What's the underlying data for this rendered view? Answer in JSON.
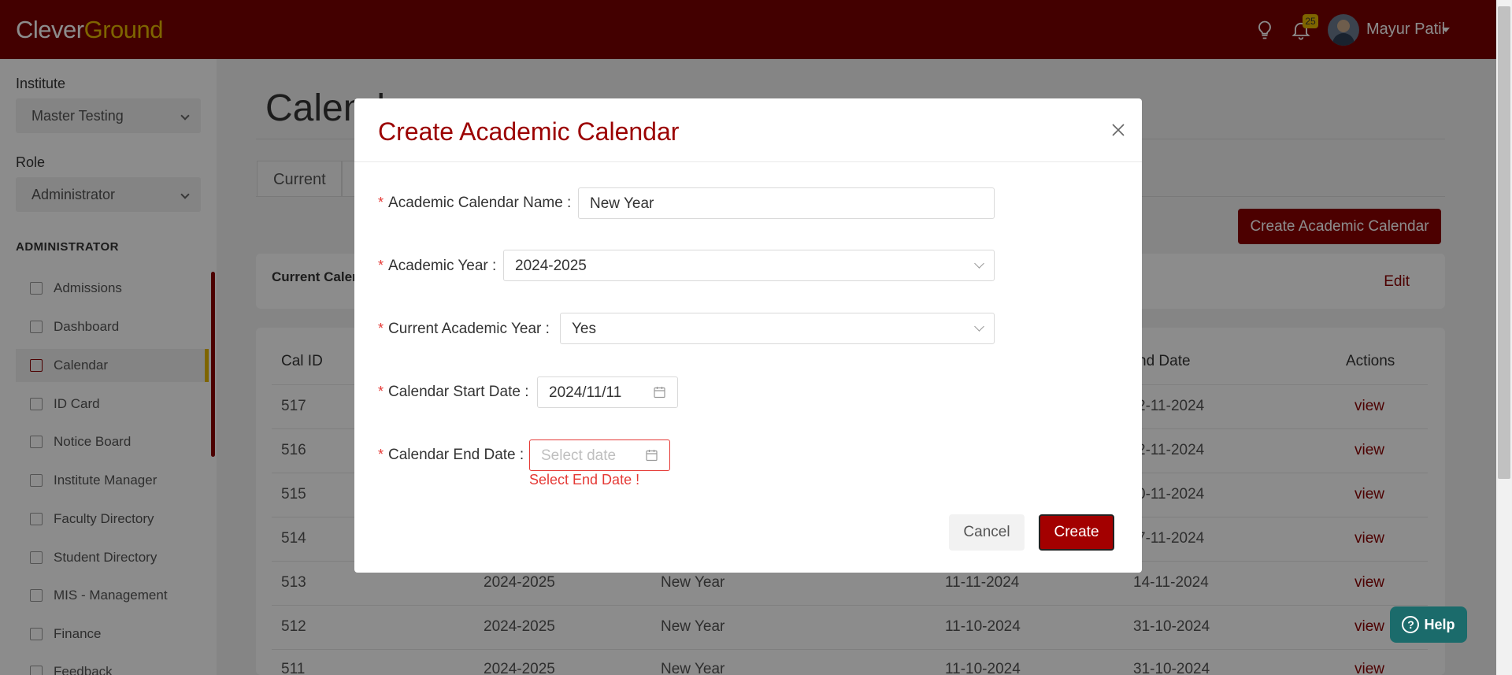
{
  "header": {
    "logo_part1": "Clever",
    "logo_part2": "Ground",
    "notification_count": "25",
    "user_name": "Mayur Patil"
  },
  "sidebar": {
    "institute_label": "Institute",
    "institute_value": "Master Testing",
    "role_label": "Role",
    "role_value": "Administrator",
    "section_title": "ADMINISTRATOR",
    "items": [
      {
        "label": "Admissions",
        "icon": "book-icon"
      },
      {
        "label": "Dashboard",
        "icon": "chart-line-icon"
      },
      {
        "label": "Calendar",
        "icon": "book-icon",
        "active": true
      },
      {
        "label": "ID Card",
        "icon": "book-icon"
      },
      {
        "label": "Notice Board",
        "icon": "megaphone-icon"
      },
      {
        "label": "Institute Manager",
        "icon": "grid-icon"
      },
      {
        "label": "Faculty Directory",
        "icon": "graduation-cap-icon"
      },
      {
        "label": "Student Directory",
        "icon": "users-icon"
      },
      {
        "label": "MIS - Management",
        "icon": "book-icon"
      },
      {
        "label": "Finance",
        "icon": "folder-icon"
      },
      {
        "label": "Feedback",
        "icon": "folder-icon"
      }
    ]
  },
  "main": {
    "page_title": "Calend",
    "tab_current": "Current",
    "create_button": "Create Academic Calendar",
    "current_label": "Current Calen",
    "edit_label": "Edit",
    "table": {
      "headers": [
        "Cal ID",
        "nd Date",
        "Actions"
      ],
      "rows": [
        {
          "id": "517",
          "year": "",
          "name": "",
          "start": "",
          "end": "2-11-2024",
          "action": "view"
        },
        {
          "id": "516",
          "year": "",
          "name": "",
          "start": "",
          "end": "2-11-2024",
          "action": "view"
        },
        {
          "id": "515",
          "year": "",
          "name": "",
          "start": "",
          "end": "0-11-2024",
          "action": "view"
        },
        {
          "id": "514",
          "year": "",
          "name": "",
          "start": "",
          "end": "7-11-2024",
          "action": "view"
        },
        {
          "id": "513",
          "year": "2024-2025",
          "name": "New Year",
          "start": "11-11-2024",
          "end": "14-11-2024",
          "action": "view"
        },
        {
          "id": "512",
          "year": "2024-2025",
          "name": "New Year",
          "start": "11-10-2024",
          "end": "31-10-2024",
          "action": "view"
        },
        {
          "id": "511",
          "year": "2024-2025",
          "name": "New Year",
          "start": "11-10-2024",
          "end": "31-10-2024",
          "action": "view"
        }
      ]
    }
  },
  "modal": {
    "title": "Create Academic Calendar",
    "fields": {
      "name_label": "Academic Calendar Name",
      "name_value": "New Year",
      "year_label": "Academic Year",
      "year_value": "2024-2025",
      "current_label": "Current Academic Year",
      "current_value": "Yes",
      "start_label": "Calendar Start Date",
      "start_value": "2024/11/11",
      "end_label": "Calendar End Date",
      "end_placeholder": "Select date",
      "end_error": "Select End Date !"
    },
    "cancel_label": "Cancel",
    "create_label": "Create"
  },
  "help": {
    "label": "Help"
  },
  "colors": {
    "brand": "#7a0000",
    "accent": "#e6b800",
    "error": "#e53935",
    "help": "#1b6b6b"
  }
}
